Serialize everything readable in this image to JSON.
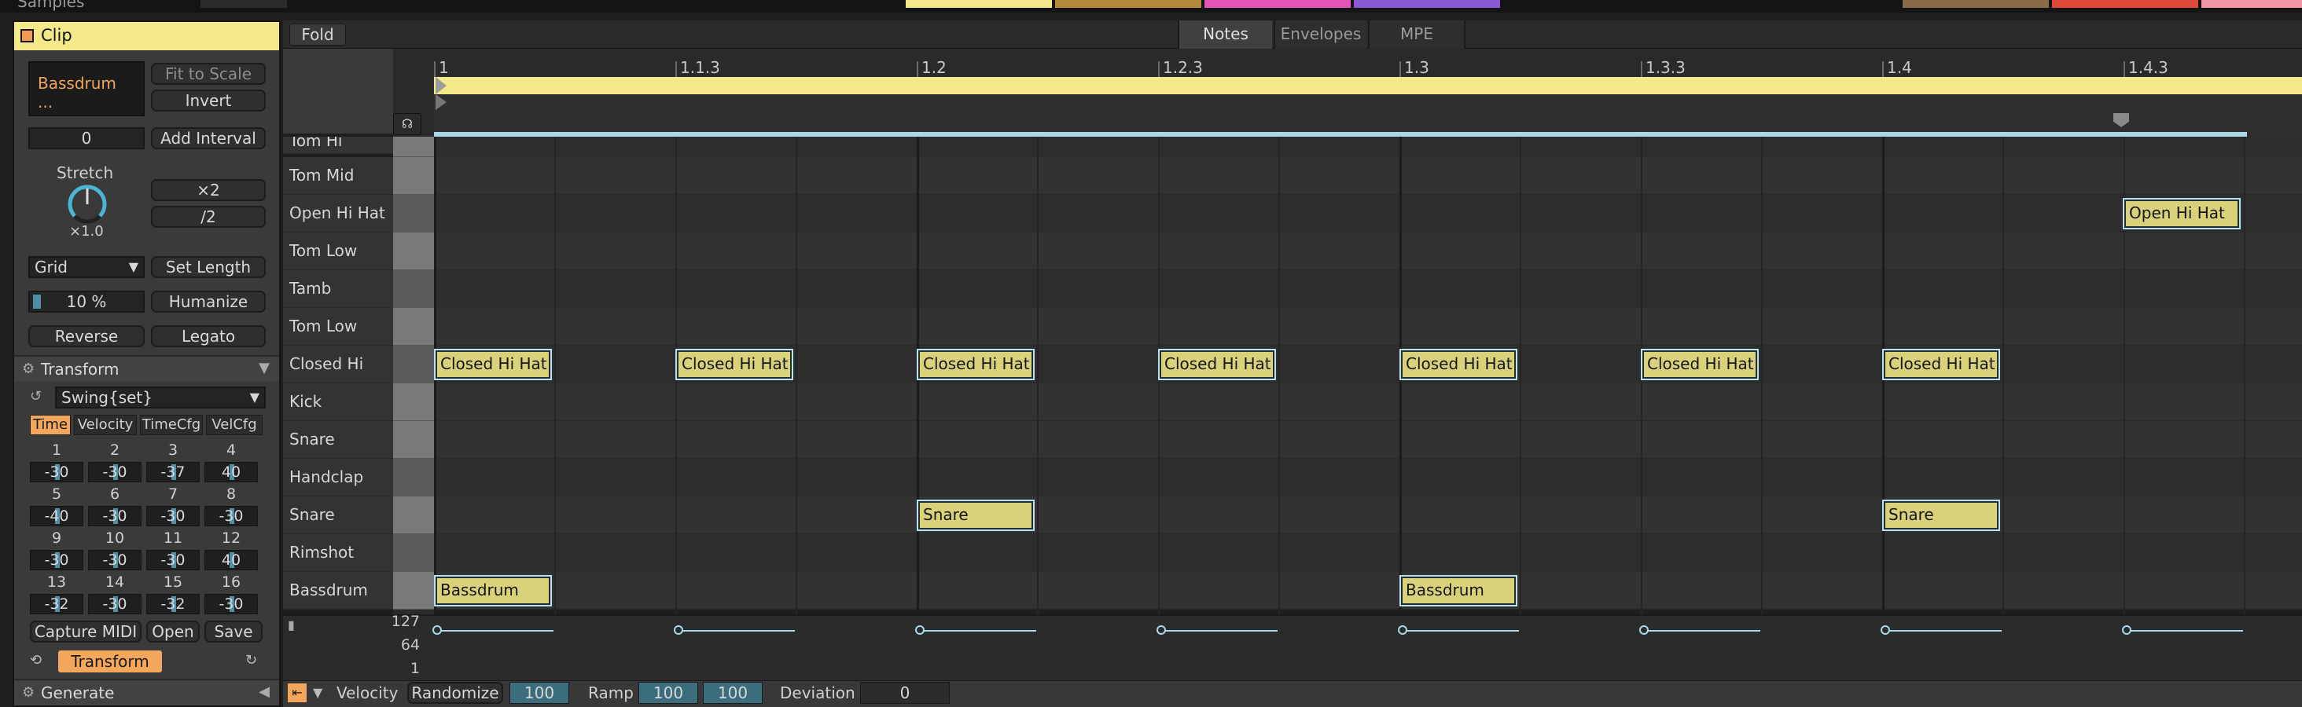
{
  "top": {
    "samples_label": "Samples"
  },
  "clip_panel": {
    "title": "Clip",
    "clip_name": "Bassdrum ...",
    "fit_to_scale": "Fit to Scale",
    "invert": "Invert",
    "interval_value": "0",
    "add_interval": "Add Interval",
    "stretch_label": "Stretch",
    "stretch_value": "×1.0",
    "double": "×2",
    "half": "/2",
    "grid_select": "Grid",
    "set_length": "Set Length",
    "amount_value": "10 %",
    "humanize": "Humanize",
    "reverse": "Reverse",
    "legato": "Legato"
  },
  "transform": {
    "title": "Transform",
    "preset": "Swing{set}",
    "tabs": [
      "Time",
      "Velocity",
      "TimeCfg",
      "VelCfg"
    ],
    "numbers": [
      "1",
      "2",
      "3",
      "4",
      "5",
      "6",
      "7",
      "8",
      "9",
      "10",
      "11",
      "12",
      "13",
      "14",
      "15",
      "16"
    ],
    "values": [
      "-30",
      "-30",
      "-37",
      "40",
      "-40",
      "-30",
      "-30",
      "-30",
      "-30",
      "-30",
      "-30",
      "40",
      "-32",
      "-30",
      "-32",
      "-30"
    ],
    "capture_midi": "Capture MIDI",
    "open": "Open",
    "save": "Save",
    "transform_button": "Transform"
  },
  "generate": {
    "title": "Generate"
  },
  "editor": {
    "fold": "Fold",
    "tabs": [
      "Notes",
      "Envelopes",
      "MPE"
    ],
    "ruler": [
      "1",
      "1.1.3",
      "1.2",
      "1.2.3",
      "1.3",
      "1.3.3",
      "1.4",
      "1.4.3"
    ],
    "rows": [
      "Tom Hi",
      "Tom Mid",
      "Open Hi Hat",
      "Tom Low",
      "Tamb",
      "Tom Low",
      "Closed Hi Hat",
      "Kick",
      "Snare",
      "Handclap",
      "Snare",
      "Rimshot",
      "Bassdrum"
    ],
    "notes": {
      "open_hi_hat": "Open Hi Hat",
      "closed_hi_hat": "Closed Hi Hat",
      "snare": "Snare",
      "bassdrum": "Bassdrum"
    }
  },
  "velocity_lane": {
    "max": "127",
    "mid": "64",
    "min": "1"
  },
  "bottom_bar": {
    "velocity": "Velocity",
    "randomize": "Randomize",
    "randomize_value": "100",
    "ramp": "Ramp",
    "ramp_start": "100",
    "ramp_end": "100",
    "deviation": "Deviation",
    "deviation_value": "0"
  },
  "colors": {
    "clip": "#f3e98a",
    "accent": "#f3a75d",
    "note": "#d9d27a",
    "selection": "#a9d9e8"
  }
}
